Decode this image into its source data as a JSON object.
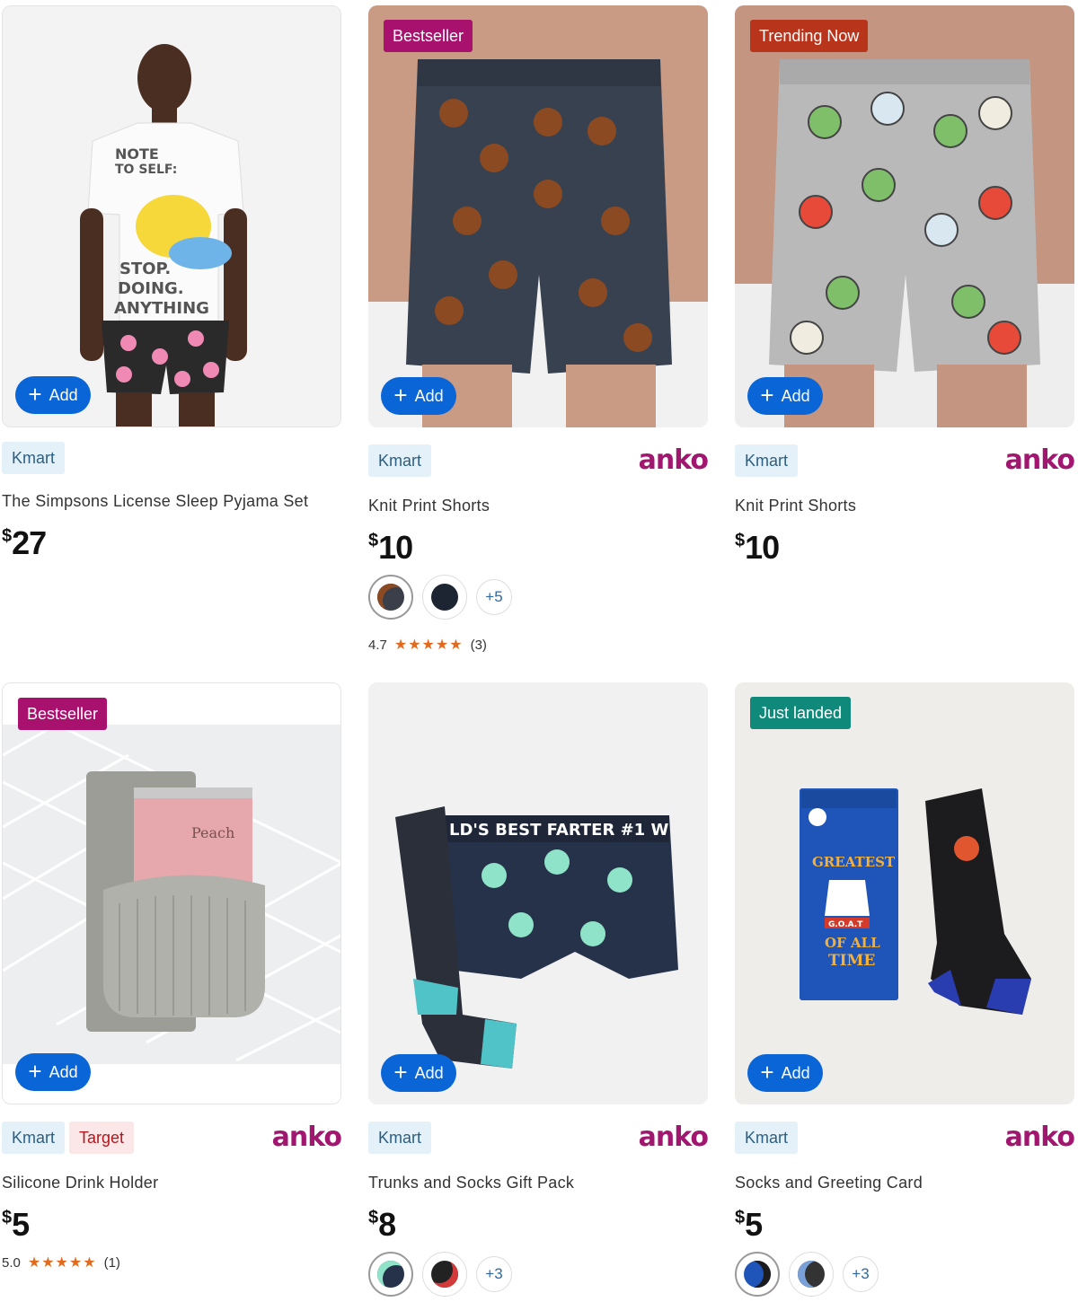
{
  "products": [
    {
      "badge": "",
      "add_label": "Add",
      "stores": [
        "Kmart"
      ],
      "brand": "",
      "title": "The Simpsons License Sleep Pyjama Set",
      "currency": "$",
      "price": "27"
    },
    {
      "badge": "Bestseller",
      "add_label": "Add",
      "stores": [
        "Kmart"
      ],
      "brand": "anko",
      "title": "Knit Print Shorts",
      "currency": "$",
      "price": "10",
      "more_swatches": "+5",
      "rating": "4.7",
      "rating_count": "(3)"
    },
    {
      "badge": "Trending Now",
      "add_label": "Add",
      "stores": [
        "Kmart"
      ],
      "brand": "anko",
      "title": "Knit Print Shorts",
      "currency": "$",
      "price": "10"
    },
    {
      "badge": "Bestseller",
      "add_label": "Add",
      "stores": [
        "Kmart",
        "Target"
      ],
      "brand": "anko",
      "title": "Silicone Drink Holder",
      "currency": "$",
      "price": "5",
      "rating": "5.0",
      "rating_count": "(1)"
    },
    {
      "badge": "",
      "add_label": "Add",
      "stores": [
        "Kmart"
      ],
      "brand": "anko",
      "title": "Trunks and Socks Gift Pack",
      "currency": "$",
      "price": "8",
      "more_swatches": "+3"
    },
    {
      "badge": "Just landed",
      "add_label": "Add",
      "stores": [
        "Kmart"
      ],
      "brand": "anko",
      "title": "Socks and Greeting Card",
      "currency": "$",
      "price": "5",
      "more_swatches": "+3"
    }
  ],
  "image_text": {
    "tee_line1": "NOTE",
    "tee_line2": "TO SELF:",
    "tee_line3": "STOP.",
    "tee_line4": "DOING.",
    "tee_line5": "ANYTHING",
    "can_label": "Peach",
    "trunks_band": "LD'S BEST FARTER  #1 W",
    "card_line1": "GREATEST",
    "card_line2": "G.O.A.T",
    "card_line3": "OF ALL",
    "card_line4": "TIME"
  },
  "colors": {
    "badge_bestseller": "#a8116e",
    "badge_trending": "#b8341b",
    "badge_just_landed": "#0f8a7a",
    "add_button": "#0a65d6",
    "brand": "#a1176f",
    "star": "#e36a1c"
  }
}
